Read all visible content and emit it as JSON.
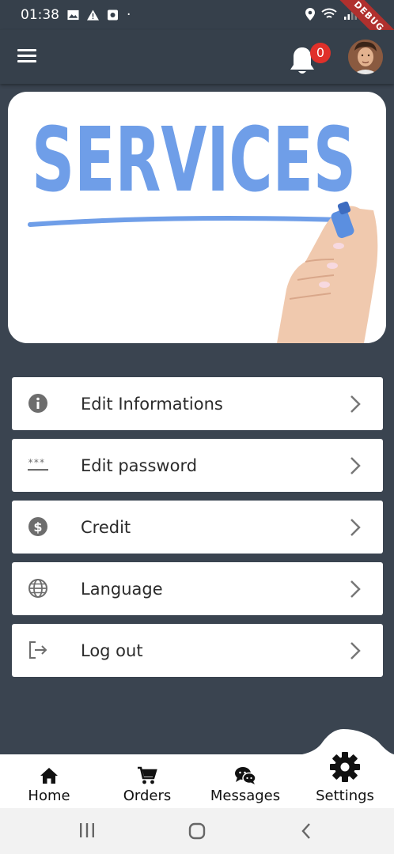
{
  "status_bar": {
    "time": "01:38",
    "dot": "·",
    "debug_label": "DEBUG"
  },
  "app_bar": {
    "notification_count": "0"
  },
  "banner": {
    "text": "SERVICES"
  },
  "menu": {
    "items": [
      {
        "label": "Edit Informations",
        "icon": "info-icon"
      },
      {
        "label": "Edit password",
        "icon": "password-icon"
      },
      {
        "label": "Credit",
        "icon": "dollar-icon"
      },
      {
        "label": "Language",
        "icon": "globe-icon"
      },
      {
        "label": "Log out",
        "icon": "logout-icon"
      }
    ]
  },
  "bottom_nav": {
    "items": [
      {
        "label": "Home",
        "icon": "home-icon"
      },
      {
        "label": "Orders",
        "icon": "cart-icon"
      },
      {
        "label": "Messages",
        "icon": "chat-icon"
      },
      {
        "label": "Settings",
        "icon": "gear-icon"
      }
    ],
    "active": "Settings"
  },
  "colors": {
    "background": "#3a4450",
    "app_bar": "#36404b",
    "badge": "#e0302a",
    "banner_text": "#6f9ee8"
  }
}
